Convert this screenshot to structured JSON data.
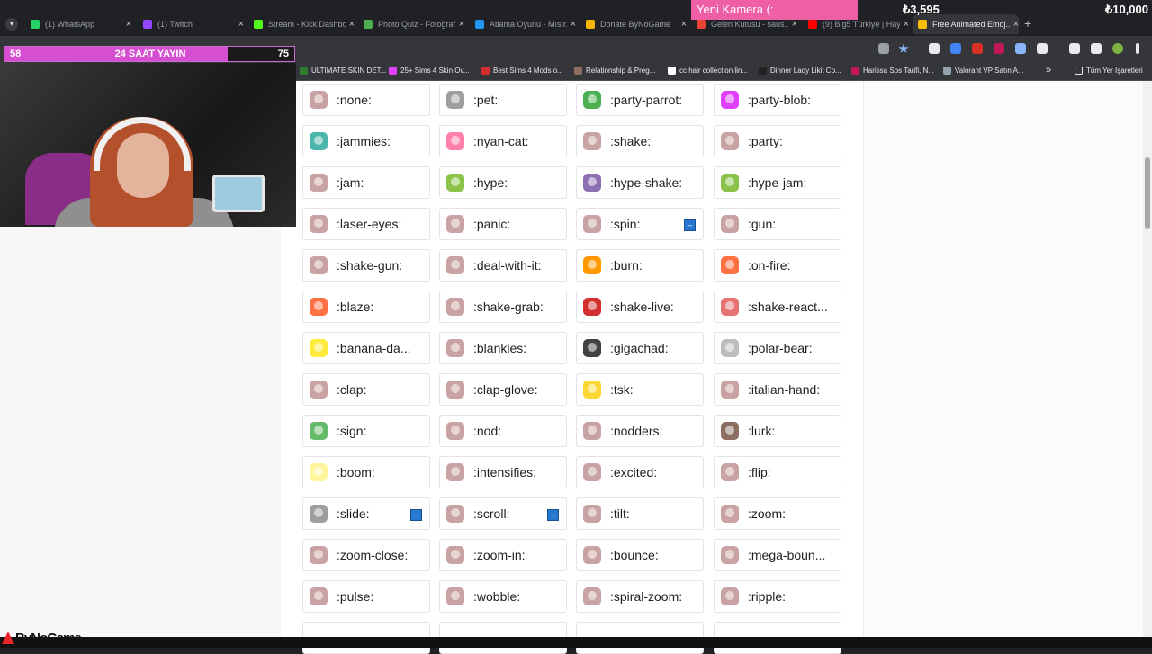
{
  "browser": {
    "tabs": [
      {
        "title": "(1) WhatsApp",
        "color": "#25d366"
      },
      {
        "title": "(1) Twitch",
        "color": "#9146ff"
      },
      {
        "title": "Stream - Kick Dashbo...",
        "color": "#53fc18"
      },
      {
        "title": "Photo Quiz - Fotoğraf...",
        "color": "#4caf50"
      },
      {
        "title": "Atlama Oyunu - Mısır...",
        "color": "#2196f3"
      },
      {
        "title": "Donate ByNoGame",
        "color": "#f4b400"
      },
      {
        "title": "Gelen Kutusu - saus...",
        "color": "#ea4335"
      },
      {
        "title": "(9) Big5 Türkiye | Hay...",
        "color": "#ff0000"
      },
      {
        "title": "Free Animated Emoj...",
        "color": "#fbbc04"
      }
    ],
    "bookmarks": [
      {
        "label": "ULTIMATE SKIN DET...",
        "color": "#2e7d32"
      },
      {
        "label": "25+ Sims 4 Skin Ov...",
        "color": "#e040fb"
      },
      {
        "label": "Best Sims 4 Mods o...",
        "color": "#d32f2f"
      },
      {
        "label": "Relationship & Preg...",
        "color": "#8d6e63"
      },
      {
        "label": "cc hair collection lin...",
        "color": "#ffffff"
      },
      {
        "label": "Dinner Lady Likit Co...",
        "color": "#212121"
      },
      {
        "label": "Harissa Sos Tarifi, N...",
        "color": "#c2185b"
      },
      {
        "label": "Valorant VP Satın A...",
        "color": "#90a4ae"
      }
    ],
    "bookmarks_more": "»",
    "all_bookmarks": "Tüm Yer İşaretleri"
  },
  "overlay": {
    "progress_left": "58",
    "progress_title": "24 SAAT YAYIN",
    "progress_right": "75",
    "progress_fraction": 0.77,
    "camera_label": "Yeni Kamera (:",
    "amount_current": "₺3,595",
    "amount_goal": "₺10,000",
    "brand": "ByNoGame"
  },
  "emojis": [
    [
      {
        "name": ":none:",
        "color": "#c9a3a3"
      },
      {
        "name": ":pet:",
        "color": "#9e9e9e"
      },
      {
        "name": ":party-parrot:",
        "color": "#4caf50"
      },
      {
        "name": ":party-blob:",
        "color": "#e040fb"
      }
    ],
    [
      {
        "name": ":jammies:",
        "color": "#4db6ac"
      },
      {
        "name": ":nyan-cat:",
        "color": "#ff80ab"
      },
      {
        "name": ":shake:",
        "color": "#c9a3a3"
      },
      {
        "name": ":party:",
        "color": "#c9a3a3"
      }
    ],
    [
      {
        "name": ":jam:",
        "color": "#c9a3a3"
      },
      {
        "name": ":hype:",
        "color": "#8bc34a"
      },
      {
        "name": ":hype-shake:",
        "color": "#8e6fb3"
      },
      {
        "name": ":hype-jam:",
        "color": "#8bc34a"
      }
    ],
    [
      {
        "name": ":laser-eyes:",
        "color": "#c9a3a3"
      },
      {
        "name": ":panic:",
        "color": "#c9a3a3"
      },
      {
        "name": ":spin:",
        "color": "#c9a3a3",
        "badge": true
      },
      {
        "name": ":gun:",
        "color": "#c9a3a3"
      }
    ],
    [
      {
        "name": ":shake-gun:",
        "color": "#c9a3a3"
      },
      {
        "name": ":deal-with-it:",
        "color": "#c9a3a3"
      },
      {
        "name": ":burn:",
        "color": "#ff9800"
      },
      {
        "name": ":on-fire:",
        "color": "#ff7043"
      }
    ],
    [
      {
        "name": ":blaze:",
        "color": "#ff7043"
      },
      {
        "name": ":shake-grab:",
        "color": "#c9a3a3"
      },
      {
        "name": ":shake-live:",
        "color": "#d32f2f"
      },
      {
        "name": ":shake-react...",
        "color": "#e57373"
      }
    ],
    [
      {
        "name": ":banana-da...",
        "color": "#ffeb3b"
      },
      {
        "name": ":blankies:",
        "color": "#c9a3a3"
      },
      {
        "name": ":gigachad:",
        "color": "#424242"
      },
      {
        "name": ":polar-bear:",
        "color": "#bdbdbd"
      }
    ],
    [
      {
        "name": ":clap:",
        "color": "#c9a3a3"
      },
      {
        "name": ":clap-glove:",
        "color": "#c9a3a3"
      },
      {
        "name": ":tsk:",
        "color": "#fdd835"
      },
      {
        "name": ":italian-hand:",
        "color": "#c9a3a3"
      }
    ],
    [
      {
        "name": ":sign:",
        "color": "#66bb6a"
      },
      {
        "name": ":nod:",
        "color": "#c9a3a3"
      },
      {
        "name": ":nodders:",
        "color": "#c9a3a3"
      },
      {
        "name": ":lurk:",
        "color": "#8d6e63"
      }
    ],
    [
      {
        "name": ":boom:",
        "color": "#fff59d"
      },
      {
        "name": ":intensifies:",
        "color": "#c9a3a3"
      },
      {
        "name": ":excited:",
        "color": "#c9a3a3"
      },
      {
        "name": ":flip:",
        "color": "#c9a3a3"
      }
    ],
    [
      {
        "name": ":slide:",
        "color": "#9e9e9e",
        "badge": true
      },
      {
        "name": ":scroll:",
        "color": "#c9a3a3",
        "badge": true
      },
      {
        "name": ":tilt:",
        "color": "#c9a3a3"
      },
      {
        "name": ":zoom:",
        "color": "#c9a3a3"
      }
    ],
    [
      {
        "name": ":zoom-close:",
        "color": "#c9a3a3"
      },
      {
        "name": ":zoom-in:",
        "color": "#c9a3a3"
      },
      {
        "name": ":bounce:",
        "color": "#c9a3a3"
      },
      {
        "name": ":mega-boun...",
        "color": "#c9a3a3"
      }
    ],
    [
      {
        "name": ":pulse:",
        "color": "#c9a3a3"
      },
      {
        "name": ":wobble:",
        "color": "#c9a3a3"
      },
      {
        "name": ":spiral-zoom:",
        "color": "#c9a3a3"
      },
      {
        "name": ":ripple:",
        "color": "#c9a3a3"
      }
    ]
  ],
  "badge_glyph": "–"
}
